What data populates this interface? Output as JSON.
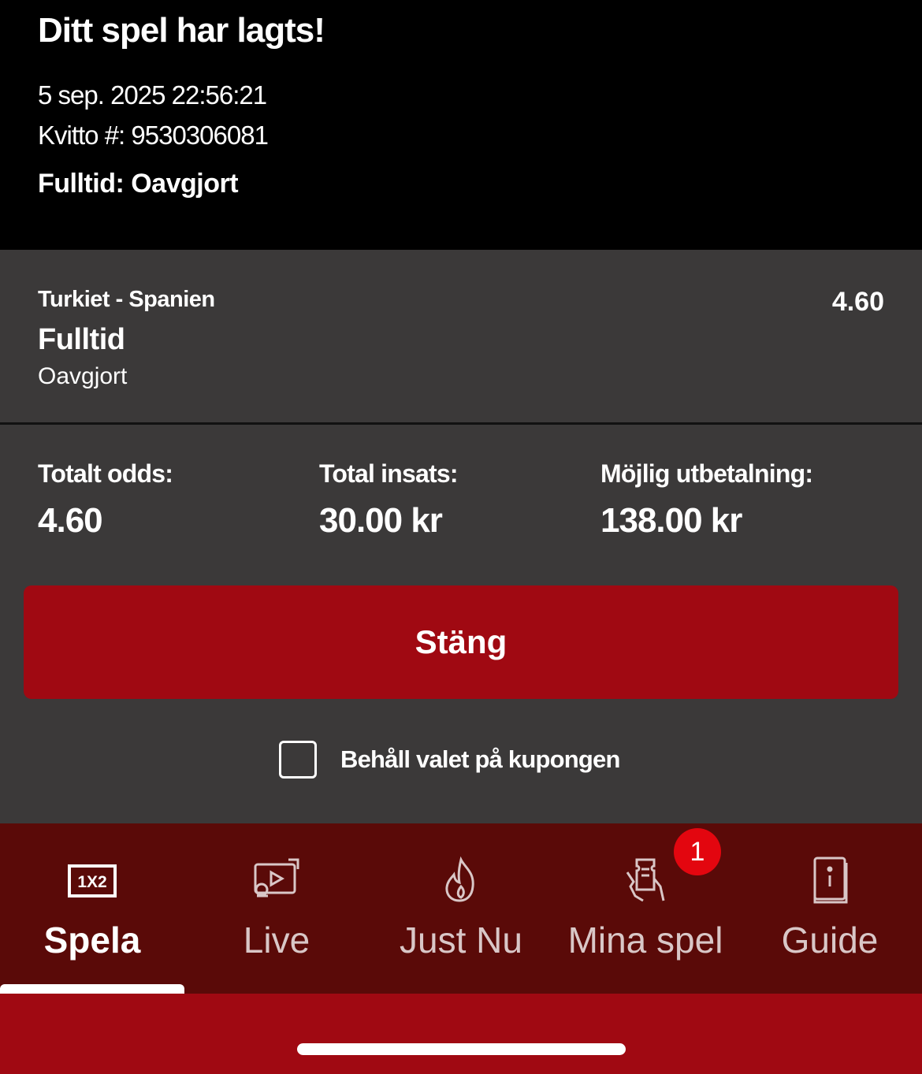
{
  "header": {
    "title": "Ditt spel har lagts!",
    "date": "5 sep. 2025 22:56:21",
    "receipt": "Kvitto #: 9530306081",
    "result": "Fulltid: Oavgjort"
  },
  "selection": {
    "match": "Turkiet - Spanien",
    "market": "Fulltid",
    "outcome": "Oavgjort",
    "odds": "4.60"
  },
  "summary": {
    "total_odds_label": "Totalt odds:",
    "total_odds_value": "4.60",
    "total_stake_label": "Total insats:",
    "total_stake_value": "30.00 kr",
    "payout_label": "Möjlig utbetalning:",
    "payout_value": "138.00 kr"
  },
  "actions": {
    "close_label": "Stäng",
    "keep_label": "Behåll valet på kupongen",
    "keep_checked": false
  },
  "tabbar": {
    "tabs": [
      {
        "label": "Spela",
        "icon": "1x2-icon",
        "active": true
      },
      {
        "label": "Live",
        "icon": "live-play-icon",
        "active": false
      },
      {
        "label": "Just Nu",
        "icon": "flame-icon",
        "active": false
      },
      {
        "label": "Mina spel",
        "icon": "ticket-hand-icon",
        "active": false
      },
      {
        "label": "Guide",
        "icon": "guide-book-icon",
        "active": false
      }
    ],
    "badge_count": "1",
    "icon_1x2_text": "1X2"
  },
  "colors": {
    "header_bg": "#000000",
    "panel_bg": "#3b3939",
    "brand_red": "#a00912",
    "tabbar_bg": "#5a0a08",
    "badge_red": "#e3060f"
  }
}
